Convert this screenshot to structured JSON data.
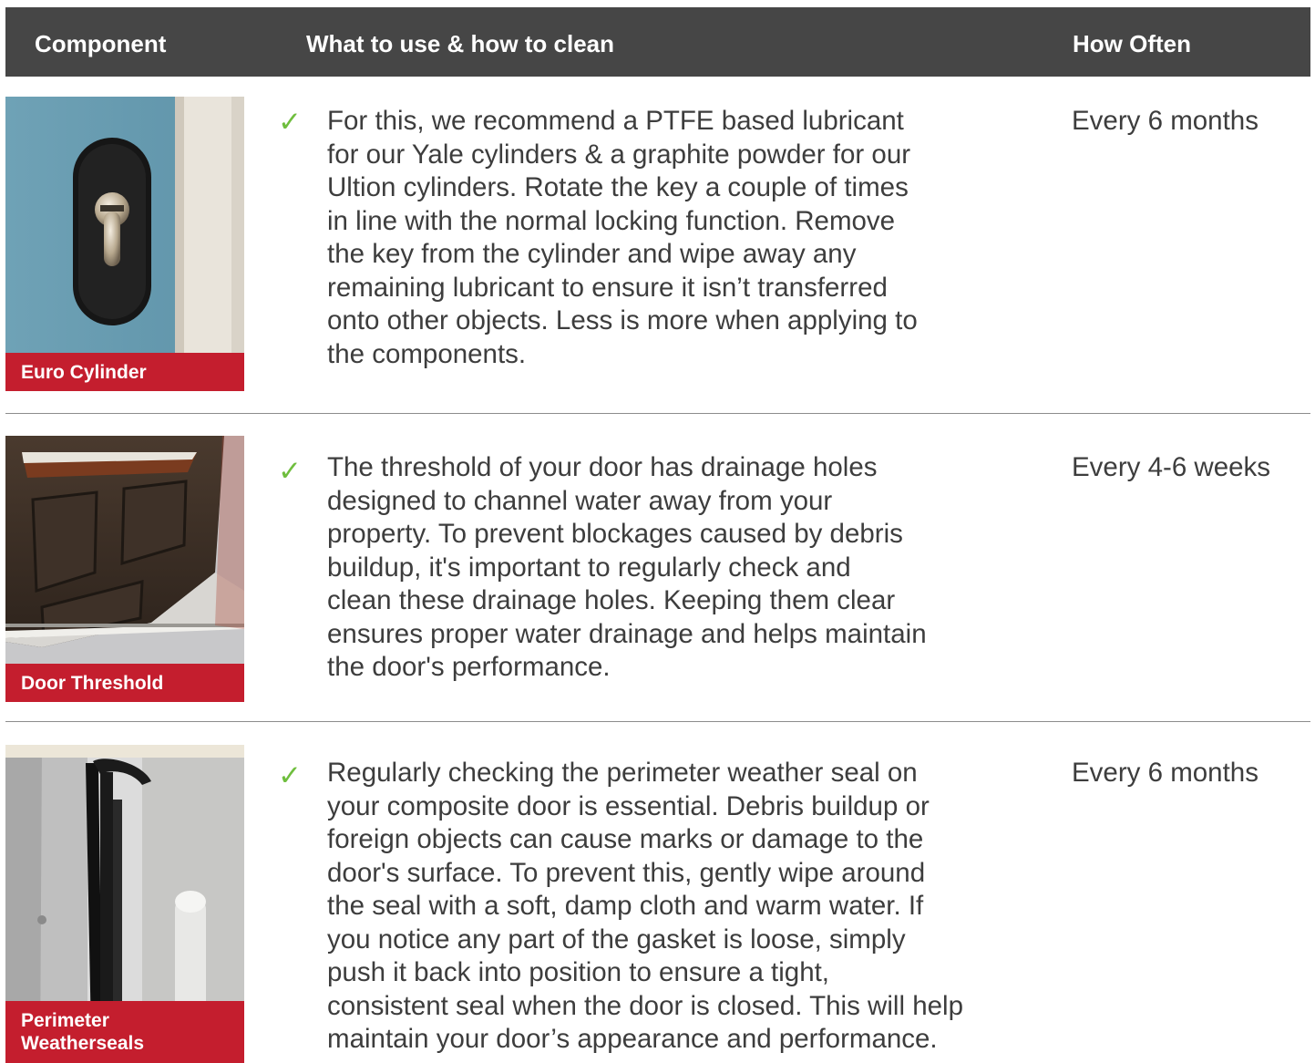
{
  "header": {
    "component": "Component",
    "what": "What to use & how to clean",
    "how_often": "How Often"
  },
  "rows": [
    {
      "caption": "Euro Cylinder",
      "check": "✓",
      "description": "For this, we recommend a PTFE based lubricant\nfor our Yale cylinders & a graphite powder for our\nUltion cylinders. Rotate the key a couple of times\nin line with the normal locking function. Remove\nthe key from the cylinder and wipe away any\nremaining lubricant to ensure it isn’t transferred\nonto other objects. Less is more when applying to\nthe components.",
      "frequency": "Every 6 months"
    },
    {
      "caption": "Door Threshold",
      "check": "✓",
      "description": "The threshold of your door has drainage holes\ndesigned to channel water away from your\nproperty. To prevent blockages caused by debris\nbuildup, it's important to regularly check and\nclean these drainage holes. Keeping them clear\nensures proper water drainage and helps maintain\nthe door's performance.",
      "frequency": "Every 4-6 weeks"
    },
    {
      "caption": "Perimeter Weatherseals",
      "check": "✓",
      "description": "Regularly checking the perimeter weather seal on\nyour composite door is essential. Debris buildup or\nforeign objects can cause marks or damage to the\ndoor's surface. To prevent this, gently wipe around\nthe seal with a soft, damp cloth and warm water. If\nyou notice any part of the gasket is loose, simply\npush it back into position to ensure a tight,\nconsistent seal when the door is closed. This will help\nmaintain your door’s appearance and performance.",
      "frequency": "Every 6 months"
    }
  ],
  "colors": {
    "header_bg": "#464646",
    "caption_bg": "#c41e2e",
    "check": "#6fbe3e",
    "text": "#3d3d3d"
  }
}
